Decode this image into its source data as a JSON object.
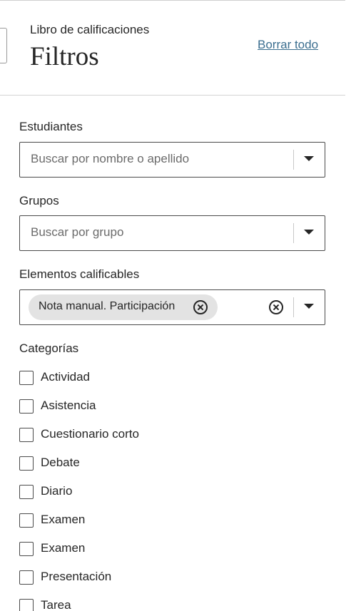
{
  "header": {
    "subtitle": "Libro de calificaciones",
    "title": "Filtros",
    "clear_all": "Borrar todo"
  },
  "students": {
    "label": "Estudiantes",
    "placeholder": "Buscar por nombre o apellido"
  },
  "groups": {
    "label": "Grupos",
    "placeholder": "Buscar por grupo"
  },
  "gradable_items": {
    "label": "Elementos calificables",
    "selected": [
      "Nota manual. Participación"
    ]
  },
  "categories": {
    "label": "Categorías",
    "items": [
      {
        "label": "Actividad",
        "checked": false
      },
      {
        "label": "Asistencia",
        "checked": false
      },
      {
        "label": "Cuestionario corto",
        "checked": false
      },
      {
        "label": "Debate",
        "checked": false
      },
      {
        "label": "Diario",
        "checked": false
      },
      {
        "label": "Examen",
        "checked": false
      },
      {
        "label": "Examen",
        "checked": false
      },
      {
        "label": "Presentación",
        "checked": false
      },
      {
        "label": "Tarea",
        "checked": false
      }
    ]
  },
  "colors": {
    "link": "#3b6e8f",
    "chip_background": "#e3e3e3",
    "border": "#4a4a4a"
  }
}
